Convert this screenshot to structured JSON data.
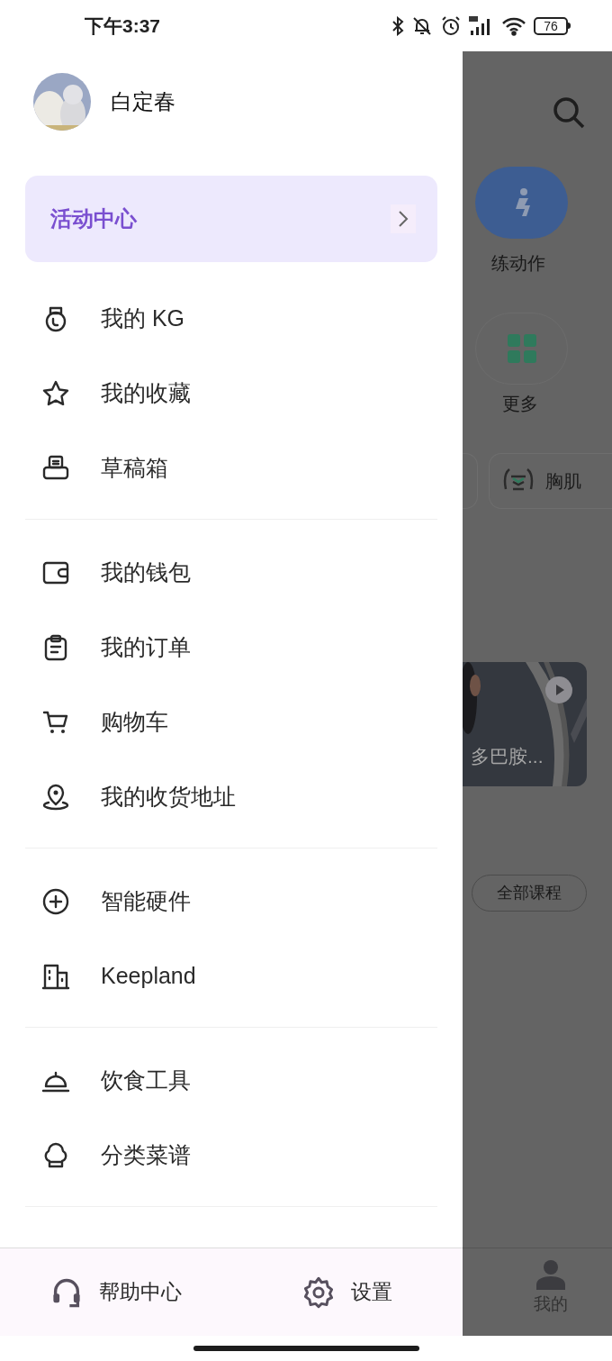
{
  "status_bar": {
    "time": "下午3:37",
    "battery": "76"
  },
  "profile": {
    "name": "白定春"
  },
  "banner": {
    "title": "活动中心"
  },
  "menu_sections": [
    {
      "items": [
        {
          "label": "我的 KG",
          "kind": "kettlebell"
        },
        {
          "label": "我的收藏",
          "kind": "star"
        },
        {
          "label": "草稿箱",
          "kind": "drafts"
        }
      ]
    },
    {
      "items": [
        {
          "label": "我的钱包",
          "kind": "wallet"
        },
        {
          "label": "我的订单",
          "kind": "clipboard"
        },
        {
          "label": "购物车",
          "kind": "cart"
        },
        {
          "label": "我的收货地址",
          "kind": "pin"
        }
      ]
    },
    {
      "items": [
        {
          "label": "智能硬件",
          "kind": "plus"
        },
        {
          "label": "Keepland",
          "kind": "building"
        }
      ]
    },
    {
      "items": [
        {
          "label": "饮食工具",
          "kind": "bell"
        },
        {
          "label": "分类菜谱",
          "kind": "chef"
        }
      ]
    }
  ],
  "footer": [
    {
      "label": "帮助中心",
      "kind": "headset"
    },
    {
      "label": "设置",
      "kind": "gear"
    }
  ],
  "background_page": {
    "action_label": "练动作",
    "more_label": "更多",
    "chip_label": "胸肌",
    "video_title": "多巴胺...",
    "all_courses": "全部课程",
    "tab_label": "我的"
  }
}
